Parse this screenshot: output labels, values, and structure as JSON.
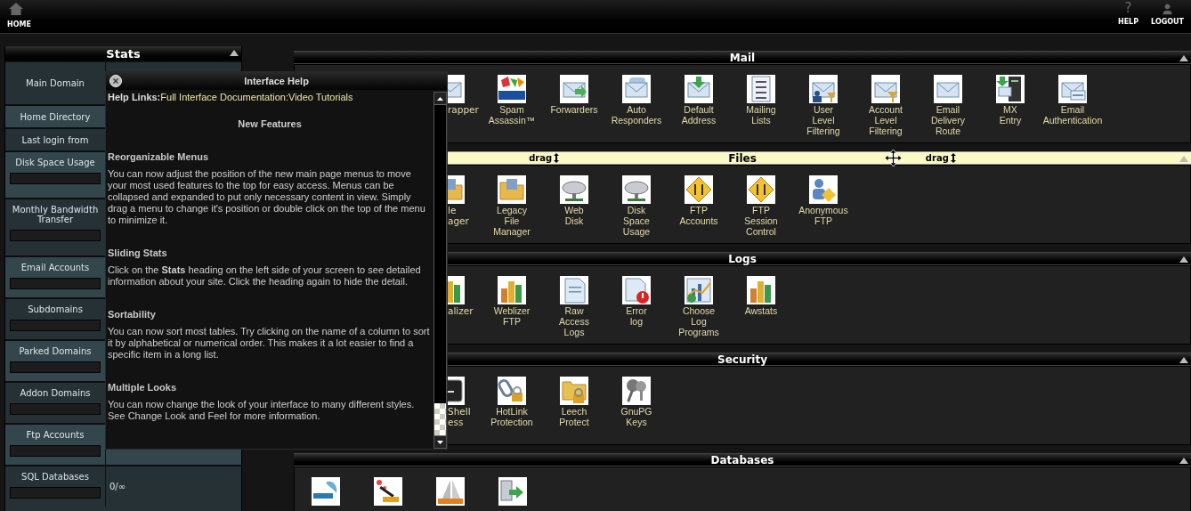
{
  "top_bar": {
    "home_label": "HOME",
    "help_glyph": "?",
    "help_label": "HELP",
    "logout_label": "LOGOUT"
  },
  "stats": {
    "title": "Stats",
    "rows": [
      {
        "label": "Main Domain",
        "kind": "text"
      },
      {
        "label": "Home Directory",
        "kind": "text"
      },
      {
        "label": "Last login from",
        "kind": "text"
      },
      {
        "label": "Disk Space Usage",
        "kind": "bar"
      },
      {
        "label": "Monthly Bandwidth Transfer",
        "kind": "bar"
      },
      {
        "label": "Email Accounts",
        "kind": "bar"
      },
      {
        "label": "Subdomains",
        "kind": "bar"
      },
      {
        "label": "Parked Domains",
        "kind": "bar"
      },
      {
        "label": "Addon Domains",
        "kind": "bar"
      },
      {
        "label": "Ftp Accounts",
        "kind": "bar"
      },
      {
        "label": "SQL Databases",
        "kind": "bar",
        "value": "0/∞"
      }
    ]
  },
  "help": {
    "title": "Interface Help",
    "links_label": "Help Links:",
    "links": [
      "Full Interface Documentation",
      "Video Tutorials"
    ],
    "link_separator": ":",
    "heading": "New Features",
    "topics": [
      {
        "title": "Reorganizable Menus",
        "text": "You can now adjust the position of the new main page menus to move your most used features to the top for easy access. Menus can be collapsed and expanded to put only necessary content in view. Simply drag a menu to change it's position or double click on the top of the menu to minimize it."
      },
      {
        "title": "Sliding Stats",
        "text": "Click on the **Stats** heading on the left side of your screen to see detailed information about your site. Click the heading again to hide the detail."
      },
      {
        "title": "Sortability",
        "text": "You can now sort most tables. Try clicking on the name of a column to sort it by alphabetical or numerical order. This makes it a lot easier to find a specific item in a long list."
      },
      {
        "title": "Multiple Looks",
        "text": "You can now change the look of your interface to many different styles. See Change Look and Feel for more information."
      }
    ]
  },
  "sections": [
    {
      "title": "Mail",
      "highlighted": false,
      "items": [
        {
          "label": "rapper",
          "kind": "partial"
        },
        {
          "label": "Spam Assassin™",
          "kind": "full"
        },
        {
          "label": "Forwarders",
          "kind": "full"
        },
        {
          "label": "Auto Responders",
          "kind": "full"
        },
        {
          "label": "Default Address",
          "kind": "full"
        },
        {
          "label": "Mailing Lists",
          "kind": "full"
        },
        {
          "label": "User Level Filtering",
          "kind": "full"
        },
        {
          "label": "Account Level Filtering",
          "kind": "full"
        },
        {
          "label": "Email Delivery Route",
          "kind": "full"
        },
        {
          "label": "MX Entry",
          "kind": "full"
        },
        {
          "label": "Email Authentication",
          "kind": "full"
        }
      ]
    },
    {
      "title": "Files",
      "highlighted": true,
      "drag_labels": [
        "drag",
        "drag"
      ],
      "items": [
        {
          "label": "le\nager",
          "kind": "partial"
        },
        {
          "label": "Legacy File Manager",
          "kind": "full"
        },
        {
          "label": "Web Disk",
          "kind": "full"
        },
        {
          "label": "Disk Space Usage",
          "kind": "full"
        },
        {
          "label": "FTP Accounts",
          "kind": "full"
        },
        {
          "label": "FTP Session Control",
          "kind": "full"
        },
        {
          "label": "Anonymous FTP",
          "kind": "full"
        }
      ]
    },
    {
      "title": "Logs",
      "highlighted": false,
      "items": [
        {
          "label": "alizer",
          "kind": "partial"
        },
        {
          "label": "Weblizer FTP",
          "kind": "full"
        },
        {
          "label": "Raw Access Logs",
          "kind": "full"
        },
        {
          "label": "Error log",
          "kind": "full"
        },
        {
          "label": "Choose Log Programs",
          "kind": "full"
        },
        {
          "label": "Awstats",
          "kind": "full"
        }
      ]
    },
    {
      "title": "Security",
      "highlighted": false,
      "items": [
        {
          "label": "Shell\ness",
          "kind": "partial"
        },
        {
          "label": "HotLink Protection",
          "kind": "full"
        },
        {
          "label": "Leech Protect",
          "kind": "full"
        },
        {
          "label": "GnuPG Keys",
          "kind": "full"
        }
      ]
    },
    {
      "title": "Databases",
      "highlighted": false,
      "items": [
        {
          "kind": "clipped"
        },
        {
          "kind": "clipped"
        },
        {
          "kind": "clipped"
        },
        {
          "kind": "clipped"
        }
      ]
    }
  ]
}
